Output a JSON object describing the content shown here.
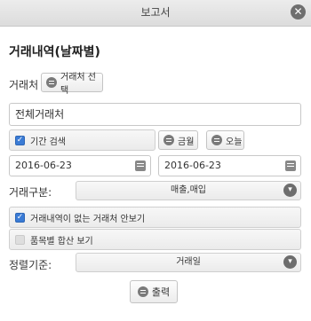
{
  "dialog": {
    "title": "보고서",
    "close_icon": "close-icon"
  },
  "section_heading": "거래내역(날짜별)",
  "client": {
    "label": "거래처",
    "select_button": "거래처 선택",
    "value": "전체거래처"
  },
  "period": {
    "checkbox_label": "기간 검색",
    "checked": true,
    "this_month_button": "금월",
    "today_button": "오늘",
    "start_date": "2016-06-23",
    "end_date": "2016-06-23"
  },
  "trade_type": {
    "label": "거래구분:",
    "selected": "매출,매입"
  },
  "options": {
    "hide_no_trade_label": "거래내역이 없는 거래처 안보기",
    "hide_no_trade_checked": true,
    "sum_by_item_label": "품목별 합산 보기",
    "sum_by_item_checked": false
  },
  "sort": {
    "label": "정렬기준:",
    "selected": "거래일"
  },
  "print_button": "출력",
  "colors": {
    "accent": "#3a7bd5",
    "titlebar": "#e4e4e4"
  }
}
